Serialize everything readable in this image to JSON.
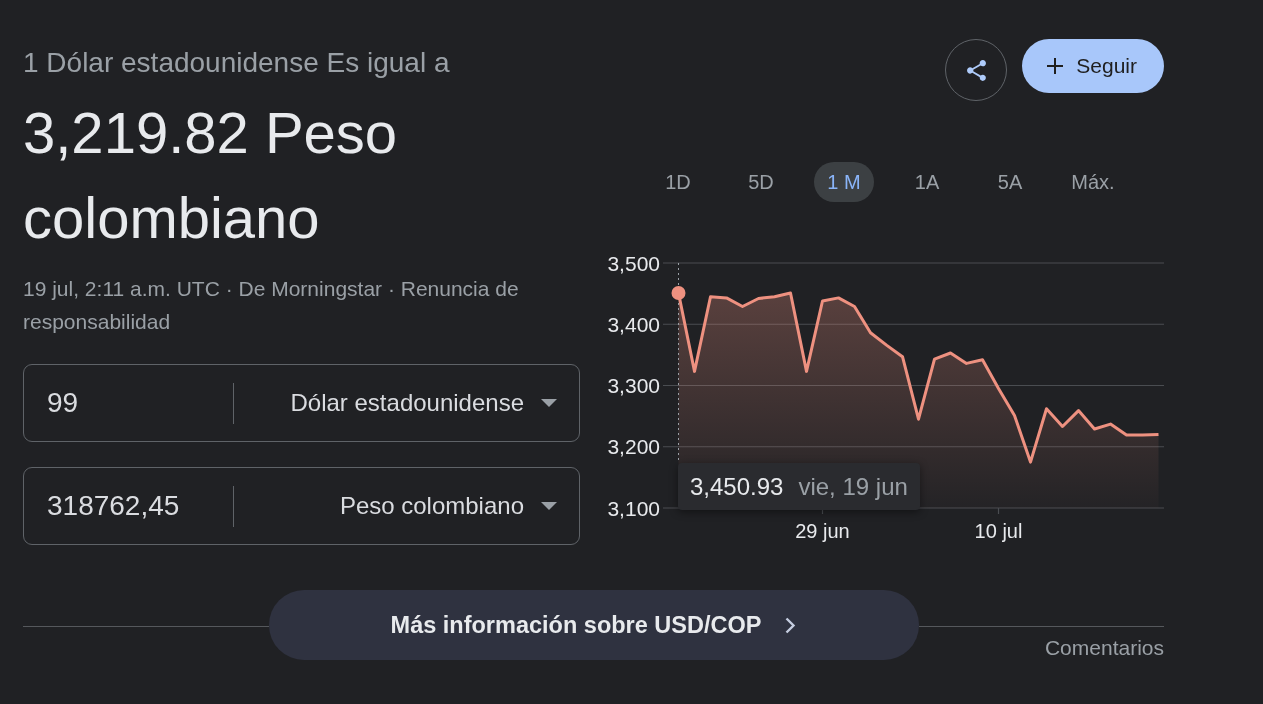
{
  "header": {
    "equals_label": "1 Dólar estadounidense Es igual a",
    "result": "3,219.82 Peso colombiano",
    "source_note": "19 jul, 2:11 a.m. UTC · De Morningstar · Renuncia de responsabilidad"
  },
  "follow_label": "Seguir",
  "converter": [
    {
      "amount": "99",
      "currency": "Dólar estadounidense"
    },
    {
      "amount": "318762,45",
      "currency": "Peso colombiano"
    }
  ],
  "ranges": [
    {
      "label": "1D",
      "selected": false
    },
    {
      "label": "5D",
      "selected": false
    },
    {
      "label": "1 M",
      "selected": true
    },
    {
      "label": "1A",
      "selected": false
    },
    {
      "label": "5A",
      "selected": false
    },
    {
      "label": "Máx.",
      "selected": false
    }
  ],
  "chart": {
    "chart_data": {
      "type": "area",
      "categories": [
        null,
        null,
        null,
        null,
        null,
        null,
        null,
        null,
        null,
        "29 jun",
        null,
        null,
        null,
        null,
        null,
        null,
        null,
        null,
        null,
        null,
        "10 jul",
        null,
        null,
        null,
        null,
        null,
        null,
        null,
        null,
        null,
        null
      ],
      "series": [
        {
          "color": "#ee9180",
          "values": [
            3451,
            3323,
            3445,
            3443,
            3429,
            3442,
            3445,
            3451,
            3323,
            3438,
            3443,
            3429,
            3386,
            3366,
            3347,
            3245,
            3343,
            3353,
            3336,
            3342,
            3295,
            3251,
            3175,
            3262,
            3233,
            3259,
            3229,
            3237,
            3219,
            3219,
            3220
          ]
        }
      ],
      "ylim": [
        3100,
        3500
      ],
      "yticks": [
        {
          "value": 3500,
          "label": "3,500"
        },
        {
          "value": 3400,
          "label": "3,400"
        },
        {
          "value": 3300,
          "label": "3,300"
        },
        {
          "value": 3200,
          "label": "3,200"
        },
        {
          "value": 3100,
          "label": "3,100"
        }
      ],
      "grid": true
    },
    "tooltip": {
      "value": "3,450.93",
      "date": "vie, 19 jun"
    }
  },
  "more_button": "Más información sobre USD/COP",
  "feedback_link": "Comentarios"
}
